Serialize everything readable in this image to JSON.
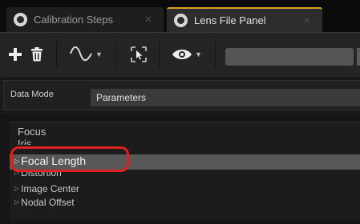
{
  "tabs": [
    {
      "label": "Calibration Steps",
      "active": false,
      "icon": "unreal-logo-icon"
    },
    {
      "label": "Lens File Panel",
      "active": true,
      "icon": "unreal-logo-icon"
    }
  ],
  "toolbar": {
    "buttons": [
      "add-icon",
      "trash-icon",
      "curve-icon",
      "select-icon",
      "eye-icon"
    ]
  },
  "data_mode": {
    "label": "Data Mode",
    "value": "Parameters"
  },
  "categories": [
    {
      "label": "Focus",
      "expandable": false
    },
    {
      "label": "Iris",
      "expandable": false
    },
    {
      "label": "Focal Length",
      "expandable": true,
      "selected": true
    },
    {
      "label": "Distortion",
      "expandable": true
    },
    {
      "label": "Image Center",
      "expandable": true
    },
    {
      "label": "Nodal Offset",
      "expandable": true
    }
  ],
  "colors": {
    "active_tab_accent": "#d9a21e",
    "annotation_red": "#e12020",
    "selection": "#575757"
  }
}
